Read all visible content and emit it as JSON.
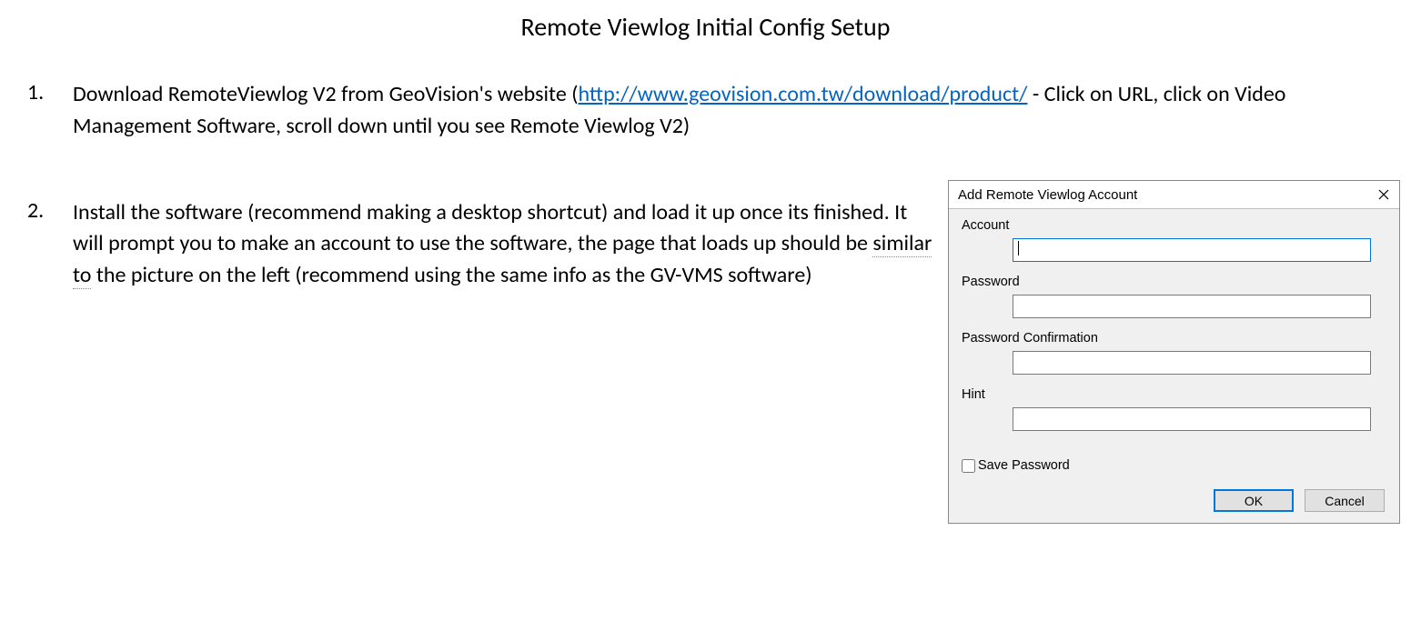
{
  "title": "Remote Viewlog Initial Config Setup",
  "steps": {
    "s1": {
      "num": "1.",
      "pre": "Download RemoteViewlog V2 from GeoVision's website (",
      "link_text": "http://www.geovision.com.tw/download/product/",
      "link_href": "http://www.geovision.com.tw/download/product/",
      "post": " - Click on URL, click on Video Management Software, scroll down until you see Remote Viewlog V2)"
    },
    "s2": {
      "num": "2.",
      "pre": "Install the software (recommend making a desktop shortcut) and load it up once its finished. It will prompt you to make an account to use the software, the page that loads up should be ",
      "similar": "similar to",
      "post": " the picture on the left (recommend using the same info as the GV-VMS software)"
    }
  },
  "dialog": {
    "title": "Add Remote Viewlog Account",
    "labels": {
      "account": "Account",
      "password": "Password",
      "password_confirm": "Password Confirmation",
      "hint": "Hint",
      "save_password": "Save Password"
    },
    "values": {
      "account": "",
      "password": "",
      "password_confirm": "",
      "hint": ""
    },
    "buttons": {
      "ok": "OK",
      "cancel": "Cancel"
    }
  }
}
